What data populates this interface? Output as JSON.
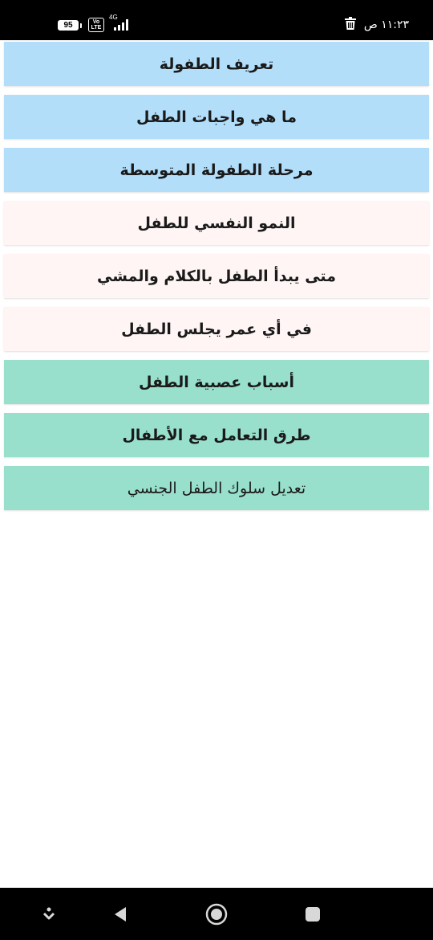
{
  "status_bar": {
    "time": "١١:٢٣ ص",
    "battery": "95",
    "volte_top": "Vo",
    "volte_bottom": "LTE",
    "network": "4G"
  },
  "items": [
    {
      "label": "تعريف الطفولة",
      "color": "#b3defa"
    },
    {
      "label": "ما هي واجبات الطفل",
      "color": "#b3defa"
    },
    {
      "label": "مرحلة الطفولة المتوسطة",
      "color": "#b3defa"
    },
    {
      "label": "النمو النفسي للطفل",
      "color": "#fff5f5"
    },
    {
      "label": "متى يبدأ الطفل بالكلام والمشي",
      "color": "#fff5f5"
    },
    {
      "label": "في أي عمر يجلس الطفل",
      "color": "#fff5f5"
    },
    {
      "label": "أسباب عصبية الطفل",
      "color": "#98e0cc"
    },
    {
      "label": "طرق التعامل مع الأطفال",
      "color": "#98e0cc"
    },
    {
      "label": "تعديل سلوك الطفل الجنسي",
      "color": "#98e0cc"
    }
  ],
  "nav_bar": {
    "icons": [
      "download-arrow-icon",
      "back-triangle-icon",
      "home-circle-icon",
      "recents-square-icon"
    ]
  }
}
